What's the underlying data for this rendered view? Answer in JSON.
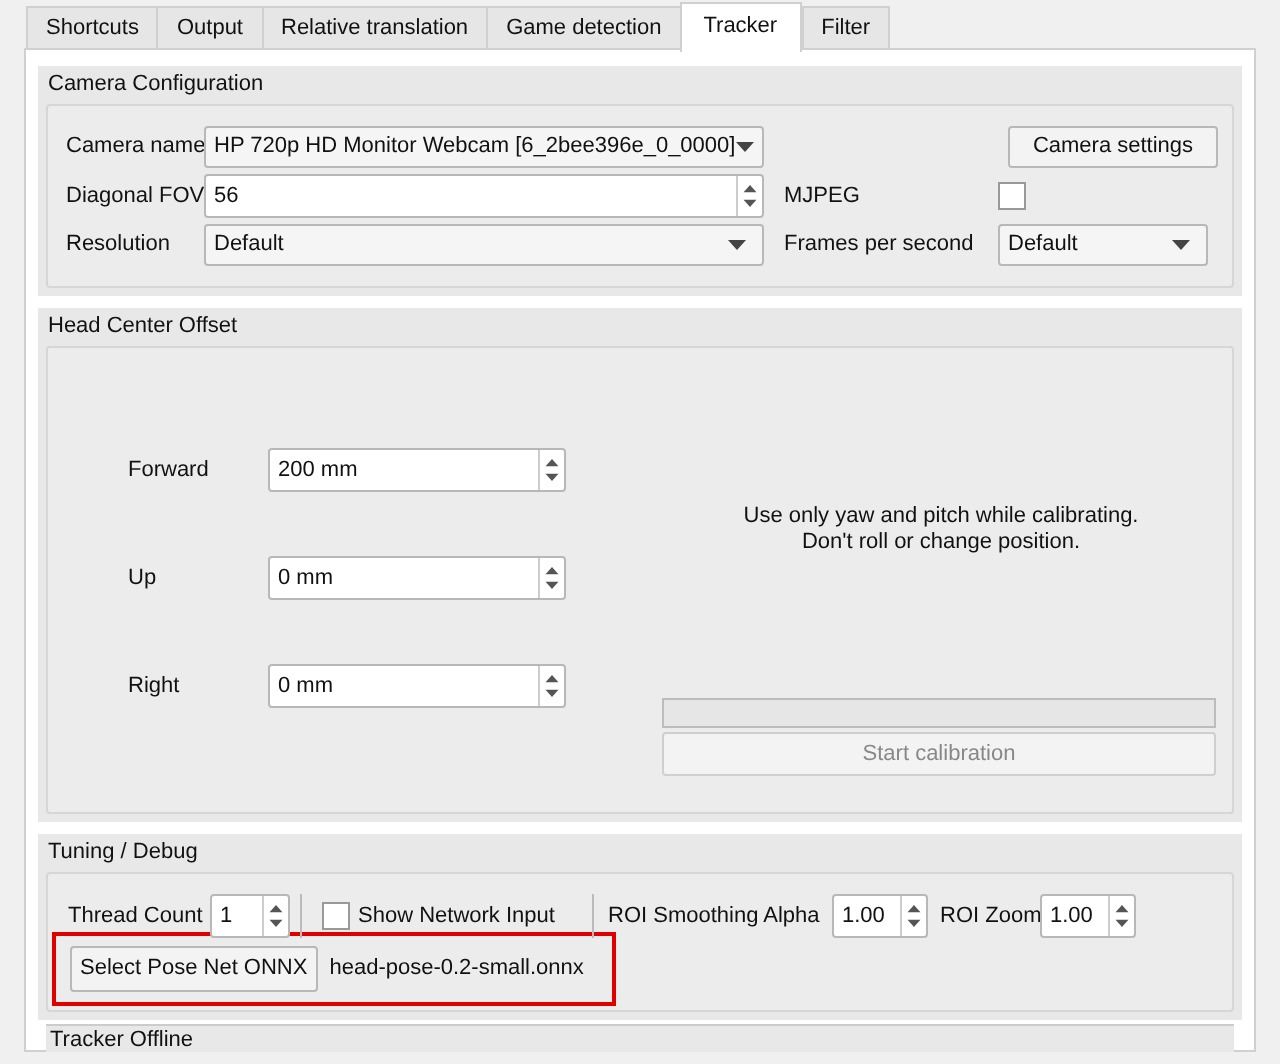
{
  "tabs": [
    {
      "label": "Shortcuts",
      "selected": false
    },
    {
      "label": "Output",
      "selected": false
    },
    {
      "label": "Relative translation",
      "selected": false
    },
    {
      "label": "Game detection",
      "selected": false
    },
    {
      "label": "Tracker",
      "selected": true
    },
    {
      "label": "Filter",
      "selected": false
    }
  ],
  "camera_configuration": {
    "title": "Camera Configuration",
    "camera_name": {
      "label": "Camera name",
      "value": "HP 720p HD Monitor Webcam [6_2bee396e_0_0000]"
    },
    "camera_settings_button": "Camera settings",
    "diagonal_fov": {
      "label": "Diagonal FOV",
      "value": "56"
    },
    "mjpeg": {
      "label": "MJPEG",
      "checked": false
    },
    "resolution": {
      "label": "Resolution",
      "value": "Default"
    },
    "frames_per_second": {
      "label": "Frames per second",
      "value": "Default"
    }
  },
  "head_center_offset": {
    "title": "Head Center Offset",
    "fields": [
      {
        "label": "Forward",
        "value": "200 mm"
      },
      {
        "label": "Up",
        "value": "0 mm"
      },
      {
        "label": "Right",
        "value": "0 mm"
      }
    ],
    "instructions": [
      "Use only yaw and pitch while calibrating.",
      "Don't roll or change position."
    ],
    "progress": {
      "level": 0
    },
    "start_button": {
      "label": "Start calibration",
      "disabled": true
    }
  },
  "tuning_debug": {
    "title": "Tuning / Debug",
    "thread_count": {
      "label": "Thread Count",
      "value": "1"
    },
    "show_network_input": {
      "label": "Show Network Input",
      "checked": false
    },
    "roi_smoothing_alpha": {
      "label": "ROI Smoothing Alpha",
      "value": "1.00"
    },
    "roi_zoom": {
      "label": "ROI Zoom",
      "value": "1.00"
    },
    "select_button": "Select Pose Net ONNX",
    "model_file": "head-pose-0.2-small.onnx",
    "highlighted": true
  },
  "status": "Tracker Offline"
}
